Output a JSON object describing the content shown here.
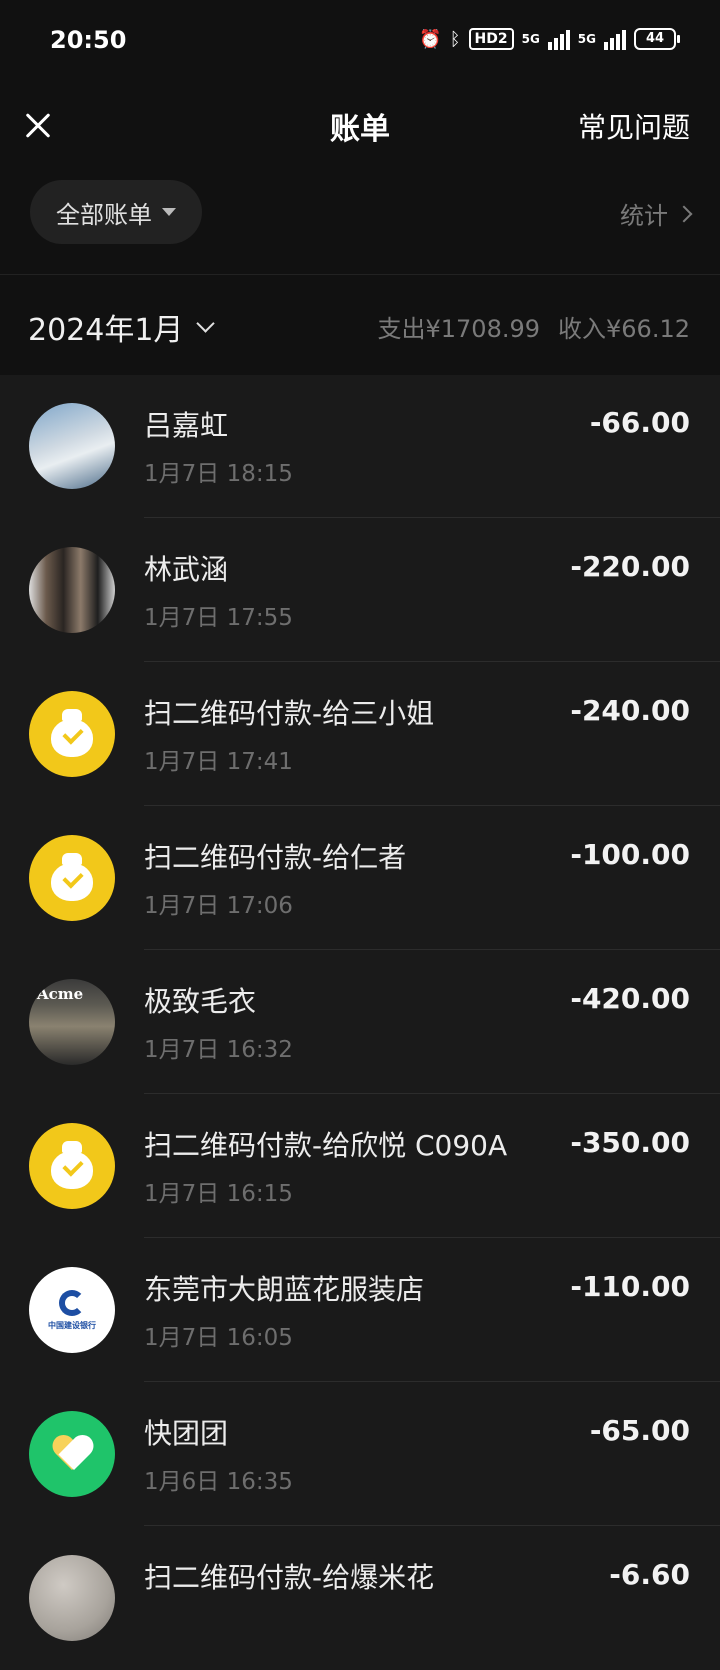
{
  "status_bar": {
    "time": "20:50",
    "hd_label": "HD2",
    "signal_label": "5G",
    "battery": "44"
  },
  "header": {
    "title": "账单",
    "faq_label": "常见问题"
  },
  "filter": {
    "label": "全部账单",
    "stats_label": "统计"
  },
  "month_summary": {
    "month": "2024年1月",
    "expense": "支出¥1708.99",
    "income": "收入¥66.12"
  },
  "transactions": [
    {
      "name": "吕嘉虹",
      "time": "1月7日 18:15",
      "amount": "-66.00",
      "icon": "user-photo-avatar"
    },
    {
      "name": "林武涵",
      "time": "1月7日 17:55",
      "amount": "-220.00",
      "icon": "user-photo-avatar"
    },
    {
      "name": "扫二维码付款-给三小姐",
      "time": "1月7日 17:41",
      "amount": "-240.00",
      "icon": "money-bag-icon"
    },
    {
      "name": "扫二维码付款-给仁者",
      "time": "1月7日 17:06",
      "amount": "-100.00",
      "icon": "money-bag-icon"
    },
    {
      "name": "极致毛衣",
      "time": "1月7日 16:32",
      "amount": "-420.00",
      "icon": "shop-photo-avatar",
      "avatar_text": "Acme"
    },
    {
      "name": "扫二维码付款-给欣悦 C090A",
      "time": "1月7日 16:15",
      "amount": "-350.00",
      "icon": "money-bag-icon"
    },
    {
      "name": "东莞市大朗蓝花服装店",
      "time": "1月7日 16:05",
      "amount": "-110.00",
      "icon": "ccb-bank-logo",
      "avatar_text": "中国建设银行"
    },
    {
      "name": "快团团",
      "time": "1月6日 16:35",
      "amount": "-65.00",
      "icon": "kuaituantuan-logo"
    },
    {
      "name": "扫二维码付款-给爆米花",
      "time": "",
      "amount": "-6.60",
      "icon": "user-photo-avatar"
    }
  ],
  "colors": {
    "background": "#1a1a1a",
    "header_bg": "#111111",
    "accent_yellow": "#f2c81a",
    "accent_green": "#1fc46a",
    "muted_text": "#6e6e6e"
  }
}
